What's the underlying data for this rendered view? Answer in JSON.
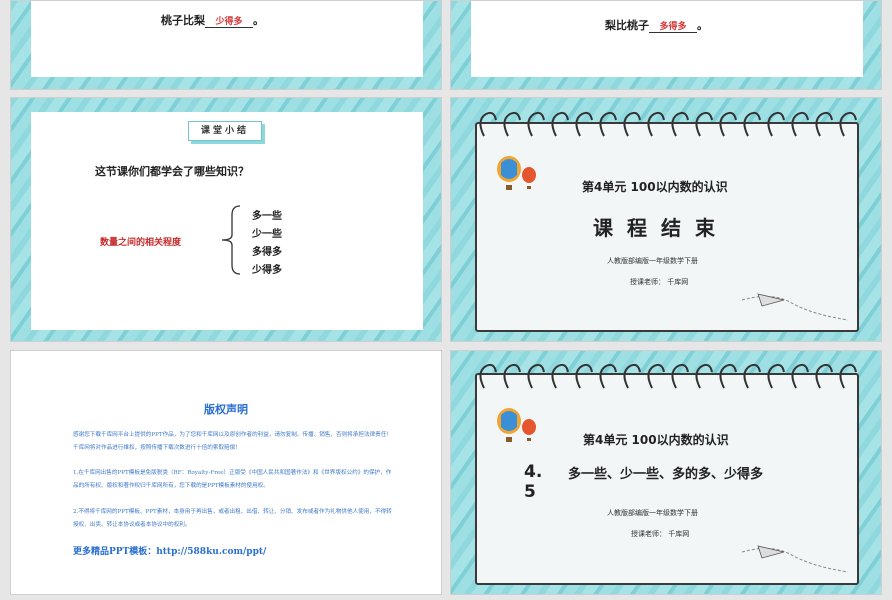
{
  "slide1": {
    "prefix": "桃子比梨",
    "answer": "少得多",
    "suffix": "。"
  },
  "slide2": {
    "prefix": "梨比桃子",
    "answer": "多得多",
    "suffix": "。"
  },
  "summary": {
    "tag": "课堂小结",
    "question": "这节课你们都学会了哪些知识？",
    "topic": "数量之间的相关程度",
    "options": [
      "多一些",
      "少一些",
      "多得多",
      "少得多"
    ]
  },
  "ending": {
    "unit": "第4单元   100以内数的认识",
    "title": "课程结束",
    "publisher": "人教版部编版一年级数学下册",
    "teacher": "授课老师：  千库网"
  },
  "copyright": {
    "title": "版权声明",
    "p1": "感谢您下载千库网平台上提供的PPT作品，为了您和千库网以及原创作者的利益，请勿复制、传播、销售，否则将承担法律责任！千库网将对作品进行维权，按照传播下载次数进行十倍的索取赔偿！",
    "p2": "1.在千库网出售的PPT模板是免版税类（RF：Royalty-Free）正版受《中国人民共和国著作法》和《世界版权公约》的保护，作品的所有权、版权和著作权归千库网所有，您下载的是PPT模板素材的使用权。",
    "p3": "2.不得将千库网的PPT模板、PPT素材，本身用于再出售，或者出租、出借、转让、分销、发布或者作为礼物供他人使用，不得转授权、出卖、转让本协议或者本协议中的权利。",
    "more": "更多精品PPT模板：http://588ku.com/ppt/"
  },
  "lesson": {
    "unit": "第4单元   100以内数的认识",
    "number": "4.5",
    "title": "多一些、少一些、多的多、少得多",
    "publisher": "人教版部编版一年级数学下册",
    "teacher": "授课老师：  千库网"
  }
}
